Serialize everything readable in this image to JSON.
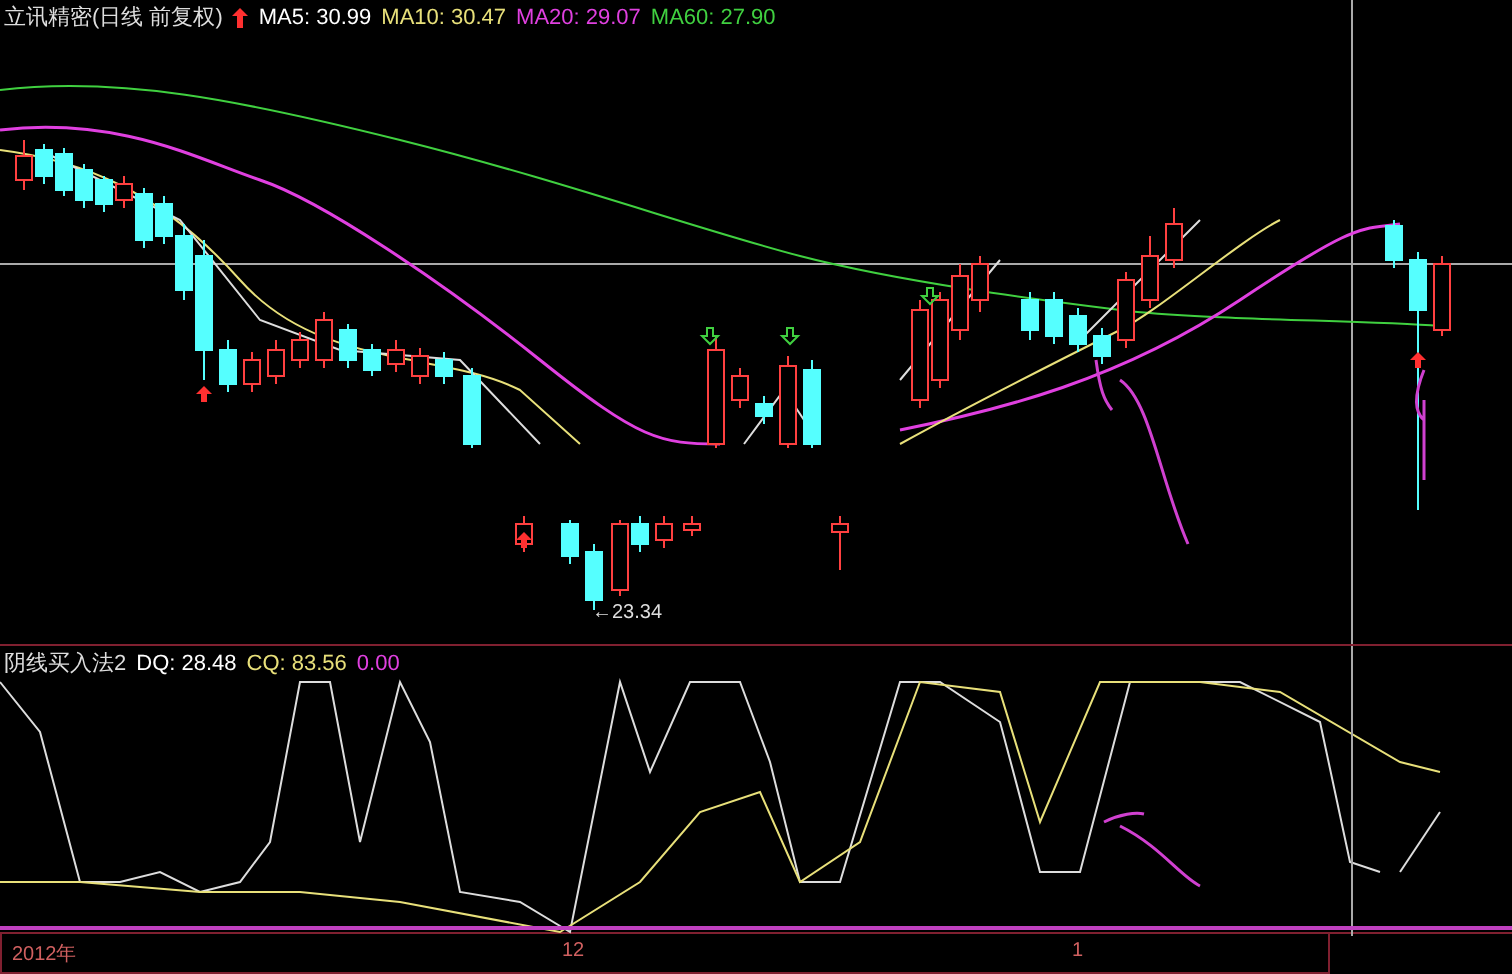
{
  "header": {
    "title": "立讯精密(日线 前复权)",
    "ma": [
      {
        "label": "MA5: 30.99",
        "color": "#ffffff"
      },
      {
        "label": "MA10: 30.47",
        "color": "#e8e07a"
      },
      {
        "label": "MA20: 29.07",
        "color": "#e040e0"
      },
      {
        "label": "MA60: 27.90",
        "color": "#40d040"
      }
    ]
  },
  "low_label": "←23.34",
  "indicator": {
    "title": "阴线买入法2",
    "values": [
      {
        "label": "DQ: 28.48",
        "color": "#ffffff"
      },
      {
        "label": "CQ: 83.56",
        "color": "#e8e07a"
      },
      {
        "label": "0.00",
        "color": "#e040e0"
      }
    ]
  },
  "axis": {
    "labels": [
      "2012年",
      "12",
      "1"
    ]
  }
}
